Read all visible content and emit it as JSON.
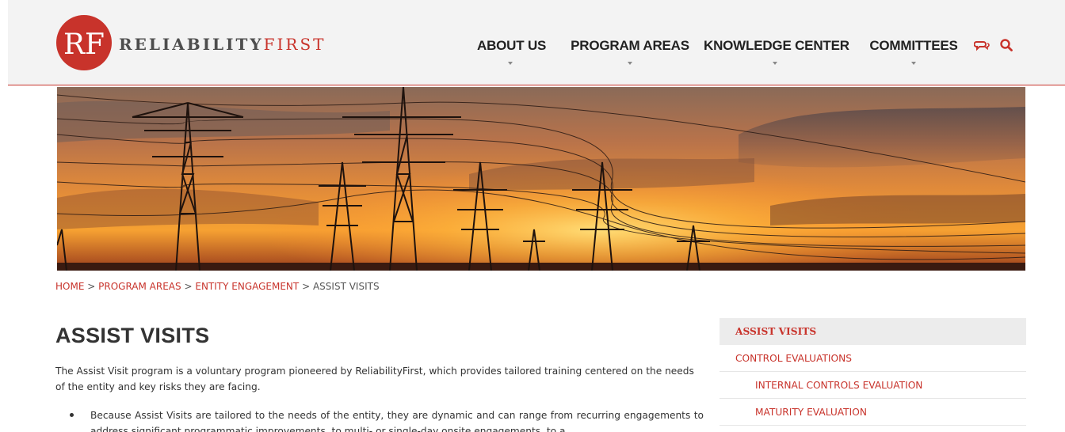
{
  "brand": {
    "initials": "RF",
    "name_part1": "RELIABILITY",
    "name_part2": "FIRST",
    "accent_color": "#c8332b"
  },
  "nav": {
    "items": [
      {
        "label": "ABOUT US"
      },
      {
        "label": "PROGRAM AREAS"
      },
      {
        "label": "KNOWLEDGE CENTER"
      },
      {
        "label": "COMMITTEES"
      }
    ],
    "icons": [
      "chat-icon",
      "search-icon"
    ]
  },
  "hero": {
    "description_icon": "power-lines-sunset-banner"
  },
  "breadcrumb": {
    "items": [
      "HOME",
      "PROGRAM AREAS",
      "ENTITY ENGAGEMENT"
    ],
    "current": "ASSIST VISITS",
    "separator": ">"
  },
  "main": {
    "title": "ASSIST VISITS",
    "intro": "The Assist Visit program is a voluntary program pioneered by ReliabilityFirst, which provides tailored training centered on the needs of the entity and key risks they are facing.",
    "bullets": [
      "Because Assist Visits are tailored to the needs of the entity, they are dynamic and can range from recurring engagements to address significant programmatic improvements, to multi- or single-day onsite engagements, to a"
    ]
  },
  "sidebar": {
    "items": [
      {
        "label": "ASSIST VISITS"
      },
      {
        "label": "CONTROL EVALUATIONS"
      },
      {
        "label": "INTERNAL CONTROLS EVALUATION"
      },
      {
        "label": "MATURITY EVALUATION"
      }
    ]
  }
}
